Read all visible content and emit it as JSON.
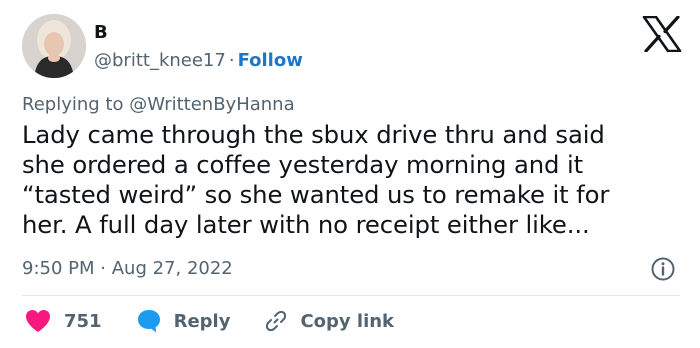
{
  "user": {
    "display_name": "B",
    "handle": "@britt_knee17",
    "separator": "·",
    "follow_label": "Follow"
  },
  "reply": {
    "prefix": "Replying to",
    "target": "@WrittenByHanna"
  },
  "tweet": {
    "lines": [
      "Lady came through the sbux drive thru and said",
      "she ordered a coffee yesterday morning and it",
      "“tasted weird” so she wanted us to remake it for",
      "her. A full day later with no receipt either like..."
    ]
  },
  "meta": {
    "time": "9:50 PM",
    "separator": "·",
    "date": "Aug 27, 2022"
  },
  "actions": {
    "like_count": "751",
    "reply_label": "Reply",
    "copy_label": "Copy link"
  },
  "icons": {
    "logo": "x-logo-icon",
    "info": "info-icon",
    "like": "heart-icon",
    "reply": "speech-bubble-icon",
    "copy": "link-icon"
  },
  "colors": {
    "text": "#0f1419",
    "muted": "#536471",
    "follow": "#1d77c9",
    "heart": "#f91880",
    "reply_bubble": "#1d9bf0"
  }
}
